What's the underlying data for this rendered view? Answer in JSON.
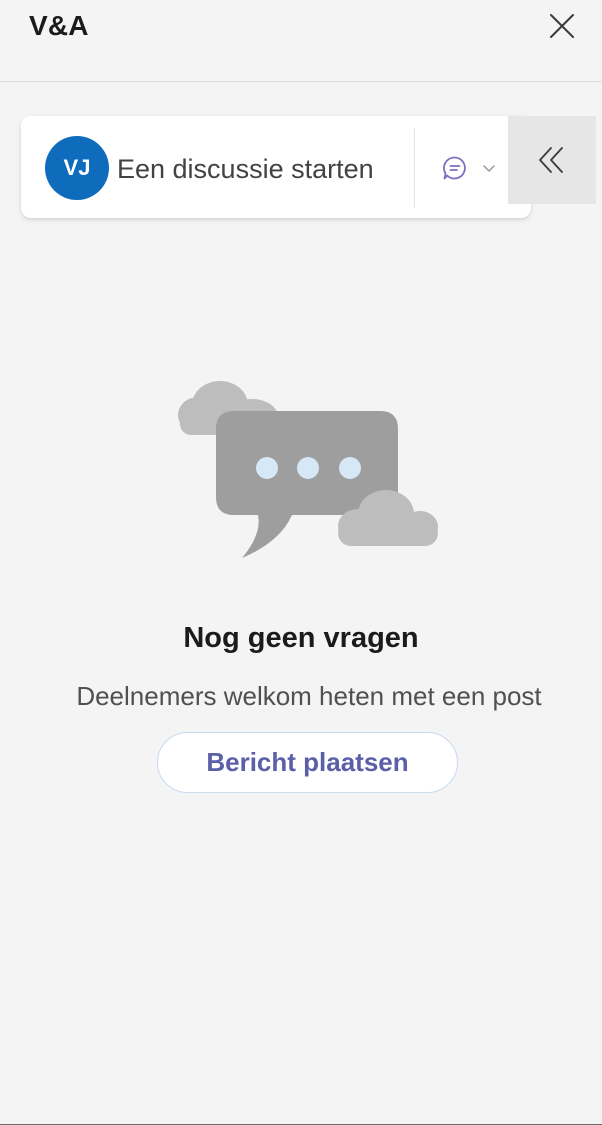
{
  "header": {
    "title": "V&A"
  },
  "composer": {
    "avatar_initials": "VJ",
    "placeholder": "Een discussie starten",
    "post_type_icon": "chat-bubble-icon",
    "dropdown_icon": "chevron-down-icon"
  },
  "side_toggle": {
    "icon": "double-chevron-left-icon"
  },
  "empty_state": {
    "illustration": "speech-bubble-with-clouds",
    "title": "Nog geen vragen",
    "subtitle": "Deelnemers welkom heten met een post",
    "button_label": "Bericht plaatsen"
  },
  "colors": {
    "avatar_bg": "#0f6cbd",
    "accent_text": "#5b5fa8",
    "background": "#f4f4f4"
  }
}
